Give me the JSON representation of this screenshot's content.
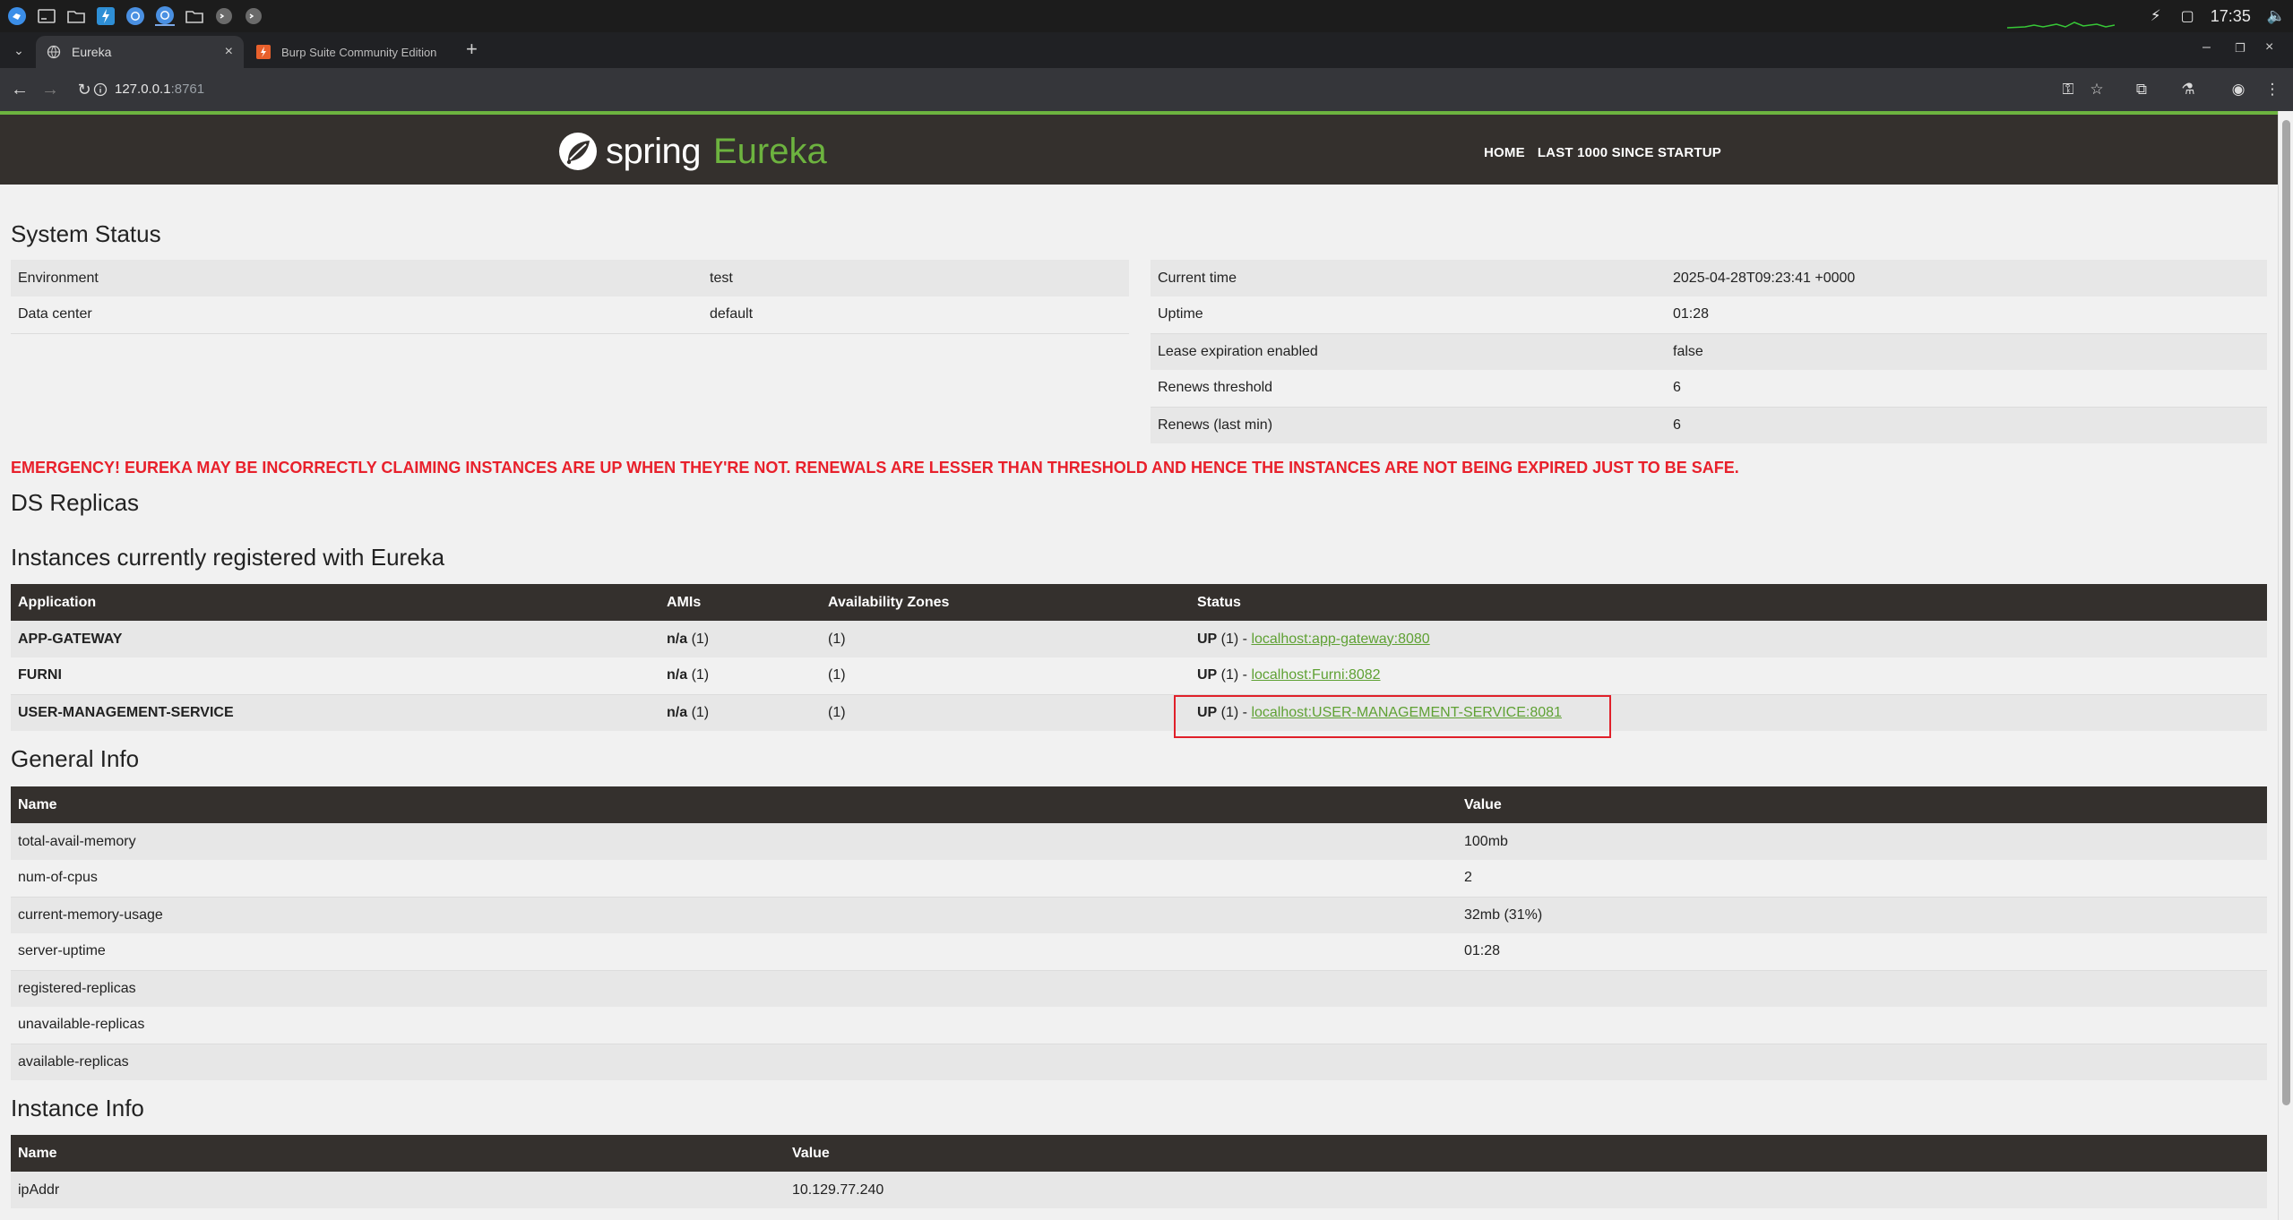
{
  "taskbar": {
    "clock": "17:35",
    "icons": [
      "app-menu-icon",
      "terminal-icon",
      "folder-icon",
      "burp-icon",
      "chrome-icon",
      "chrome-icon",
      "folder-icon",
      "app-icon",
      "app-icon"
    ]
  },
  "browser": {
    "tabs": [
      {
        "label": "Eureka",
        "active": true
      },
      {
        "label": "Burp Suite Community Edition",
        "active": false
      }
    ],
    "url_host": "127.0.0.1",
    "url_port": ":8761"
  },
  "header": {
    "brand_spring": "spring",
    "brand_eureka": "Eureka",
    "nav": [
      "HOME",
      "LAST 1000 SINCE STARTUP"
    ]
  },
  "system_status": {
    "title": "System Status",
    "left": [
      {
        "label": "Environment",
        "value": "test"
      },
      {
        "label": "Data center",
        "value": "default"
      }
    ],
    "right": [
      {
        "label": "Current time",
        "value": "2025-04-28T09:23:41 +0000"
      },
      {
        "label": "Uptime",
        "value": "01:28"
      },
      {
        "label": "Lease expiration enabled",
        "value": "false"
      },
      {
        "label": "Renews threshold",
        "value": "6"
      },
      {
        "label": "Renews (last min)",
        "value": "6"
      }
    ]
  },
  "emergency": "EMERGENCY! EUREKA MAY BE INCORRECTLY CLAIMING INSTANCES ARE UP WHEN THEY'RE NOT. RENEWALS ARE LESSER THAN THRESHOLD AND HENCE THE INSTANCES ARE NOT BEING EXPIRED JUST TO BE SAFE.",
  "ds_replicas": {
    "title": "DS Replicas"
  },
  "instances": {
    "title": "Instances currently registered with Eureka",
    "headers": [
      "Application",
      "AMIs",
      "Availability Zones",
      "Status"
    ],
    "rows": [
      {
        "app": "APP-GATEWAY",
        "ami_bold": "n/a",
        "ami_count": " (1)",
        "zones": "(1)",
        "status_prefix": "UP",
        "status_count": " (1) - ",
        "link": "localhost:app-gateway:8080"
      },
      {
        "app": "FURNI",
        "ami_bold": "n/a",
        "ami_count": " (1)",
        "zones": "(1)",
        "status_prefix": "UP",
        "status_count": " (1) - ",
        "link": "localhost:Furni:8082"
      },
      {
        "app": "USER-MANAGEMENT-SERVICE",
        "ami_bold": "n/a",
        "ami_count": " (1)",
        "zones": "(1)",
        "status_prefix": "UP",
        "status_count": " (1) - ",
        "link": "localhost:USER-MANAGEMENT-SERVICE:8081"
      }
    ]
  },
  "general_info": {
    "title": "General Info",
    "headers": [
      "Name",
      "Value"
    ],
    "rows": [
      {
        "name": "total-avail-memory",
        "value": "100mb"
      },
      {
        "name": "num-of-cpus",
        "value": "2"
      },
      {
        "name": "current-memory-usage",
        "value": "32mb (31%)"
      },
      {
        "name": "server-uptime",
        "value": "01:28"
      },
      {
        "name": "registered-replicas",
        "value": ""
      },
      {
        "name": "unavailable-replicas",
        "value": ""
      },
      {
        "name": "available-replicas",
        "value": ""
      }
    ]
  },
  "instance_info": {
    "title": "Instance Info",
    "headers": [
      "Name",
      "Value"
    ],
    "rows": [
      {
        "name": "ipAddr",
        "value": "10.129.77.240"
      }
    ]
  },
  "colors": {
    "brand_green": "#6db33f",
    "header_dark": "#34302d",
    "emergency_red": "#e8202b"
  }
}
